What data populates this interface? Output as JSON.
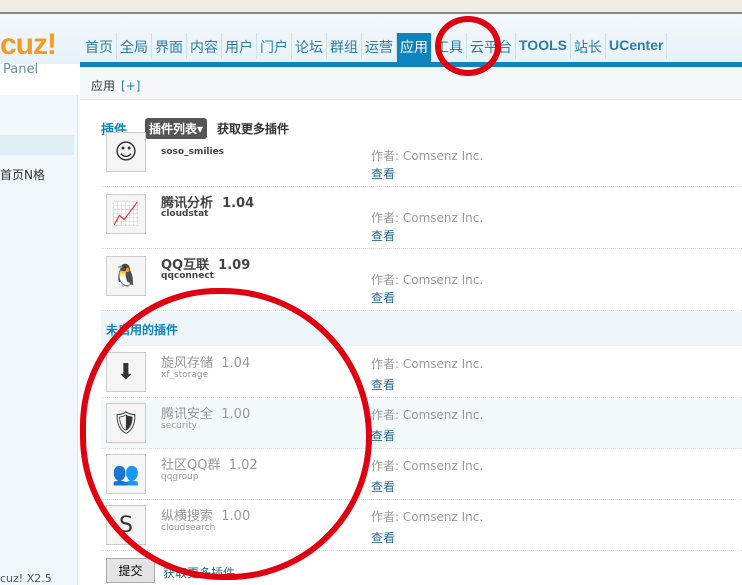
{
  "header": {
    "logo": "cuz!",
    "panel": "Panel"
  },
  "nav": [
    "首页",
    "全局",
    "界面",
    "内容",
    "用户",
    "门户",
    "论坛",
    "群组",
    "运营",
    "应用",
    "工具",
    "云平台",
    "TOOLS",
    "站长",
    "UCenter"
  ],
  "nav_active": "应用",
  "breadcrumb": {
    "label": "应用",
    "add": "[+]"
  },
  "sidebar": {
    "item": "首页N格",
    "version": "cuz! X2.5"
  },
  "tabs": {
    "title": "插件",
    "list": "插件列表▾",
    "more": "获取更多插件"
  },
  "enabled": [
    {
      "name": "",
      "version": "",
      "id": "soso_smilies",
      "author": "作者: Comsenz Inc.",
      "view": "查看",
      "icon": "smiley-icon"
    },
    {
      "name": "腾讯分析",
      "version": "1.04",
      "id": "cloudstat",
      "author": "作者: Comsenz Inc.",
      "view": "查看",
      "icon": "chart-icon"
    },
    {
      "name": "QQ互联",
      "version": "1.09",
      "id": "qqconnect",
      "author": "作者: Comsenz Inc.",
      "view": "查看",
      "icon": "penguin-icon"
    }
  ],
  "disabled_title": "未启用的插件",
  "disabled": [
    {
      "name": "旋风存储",
      "version": "1.04",
      "id": "xf_storage",
      "author": "作者: Comsenz Inc.",
      "view": "查看",
      "icon": "download-icon"
    },
    {
      "name": "腾讯安全",
      "version": "1.00",
      "id": "security",
      "author": "作者: Comsenz Inc.",
      "view": "查看",
      "icon": "shield-icon"
    },
    {
      "name": "社区QQ群",
      "version": "1.02",
      "id": "qqgroup",
      "author": "作者: Comsenz Inc.",
      "view": "查看",
      "icon": "group-icon"
    },
    {
      "name": "纵横搜索",
      "version": "1.00",
      "id": "cloudsearch",
      "author": "作者: Comsenz Inc.",
      "view": "查看",
      "icon": "search-icon"
    }
  ],
  "footer": {
    "submit": "提交",
    "more": "获取更多插件"
  },
  "colors": {
    "accent": "#0f83bd",
    "annotation": "#e0000f"
  }
}
